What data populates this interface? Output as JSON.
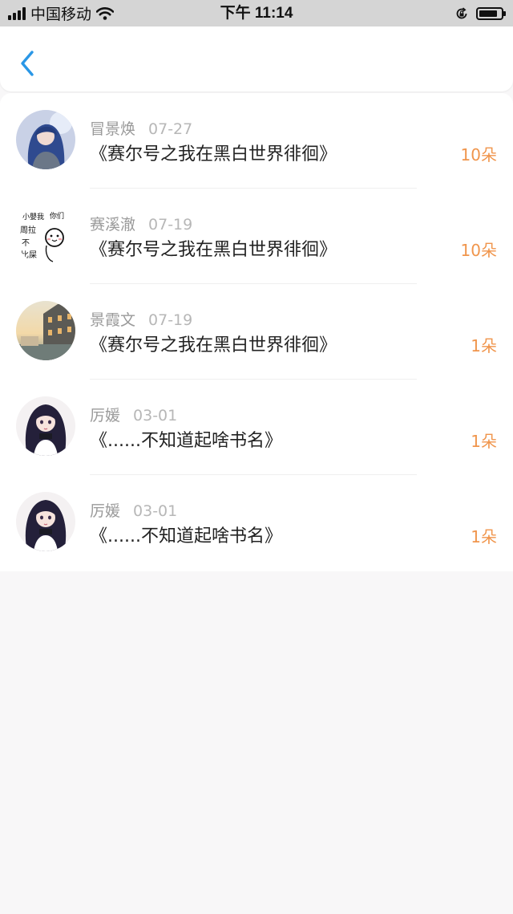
{
  "status_bar": {
    "carrier": "中国移动",
    "time": "下午 11:14"
  },
  "nav": {
    "back_icon": "chevron-left-icon",
    "accent_color": "#2a97e6"
  },
  "gifts": [
    {
      "name": "冒景焕",
      "date": "07-27",
      "book": "《赛尔号之我在黑白世界徘徊》",
      "amount": "10朵"
    },
    {
      "name": "赛溪澈",
      "date": "07-19",
      "book": "《赛尔号之我在黑白世界徘徊》",
      "amount": "10朵",
      "avatar_text": [
        "小嬰我",
        "你们",
        "周拉",
        "不",
        "比屎"
      ]
    },
    {
      "name": "景霞文",
      "date": "07-19",
      "book": "《赛尔号之我在黑白世界徘徊》",
      "amount": "1朵"
    },
    {
      "name": "厉媛",
      "date": "03-01",
      "book": "《......不知道起啥书名》",
      "amount": "1朵"
    },
    {
      "name": "厉媛",
      "date": "03-01",
      "book": "《......不知道起啥书名》",
      "amount": "1朵"
    }
  ],
  "colors": {
    "amount": "#f0954c",
    "name": "#9a9a9a",
    "title": "#222222",
    "background": "#f8f7f8"
  }
}
